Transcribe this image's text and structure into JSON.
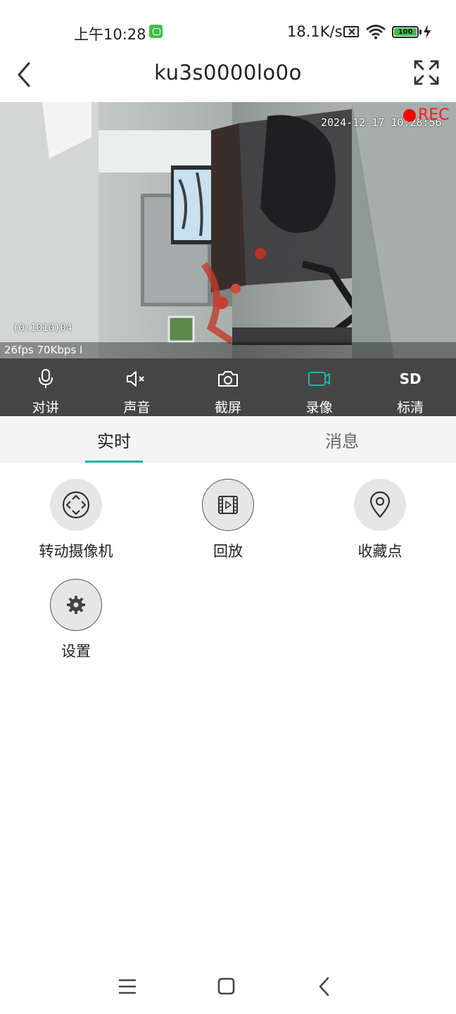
{
  "status_bar": {
    "time": "上午10:28",
    "net_speed": "18.1K/s",
    "battery": "100",
    "icons": [
      "app-notification-icon",
      "sim-icon",
      "wifi-icon",
      "battery-icon",
      "charging-bolt-icon"
    ]
  },
  "header": {
    "title": "ku3s0000lo0o",
    "back_icon": "chevron-left-icon",
    "fullscreen_icon": "expand-arrows-icon"
  },
  "video": {
    "timestamp": "2024-12-17 10:28:56",
    "rec_label": "REC",
    "channel_id": "(0:1010)04",
    "stats": "26fps 70Kbps I"
  },
  "controls": [
    {
      "label": "对讲",
      "icon": "microphone-icon"
    },
    {
      "label": "声音",
      "icon": "speaker-muted-icon"
    },
    {
      "label": "截屏",
      "icon": "camera-icon"
    },
    {
      "label": "录像",
      "icon": "video-record-icon",
      "active": true
    },
    {
      "label": "标清",
      "icon_text": "SD"
    }
  ],
  "tabs": [
    {
      "label": "实时",
      "active": true
    },
    {
      "label": "消息",
      "active": false
    }
  ],
  "functions": [
    {
      "label": "转动摄像机",
      "icon": "pan-direction-icon"
    },
    {
      "label": "回放",
      "icon": "playback-film-icon"
    },
    {
      "label": "收藏点",
      "icon": "location-pin-icon"
    },
    {
      "label": "设置",
      "icon": "gear-icon"
    }
  ],
  "colors": {
    "accent": "#20b3a8",
    "control_bar": "#454545",
    "rec": "#ff0000"
  },
  "nav_bar": [
    "menu-icon",
    "home-square-icon",
    "back-chevron-icon"
  ]
}
